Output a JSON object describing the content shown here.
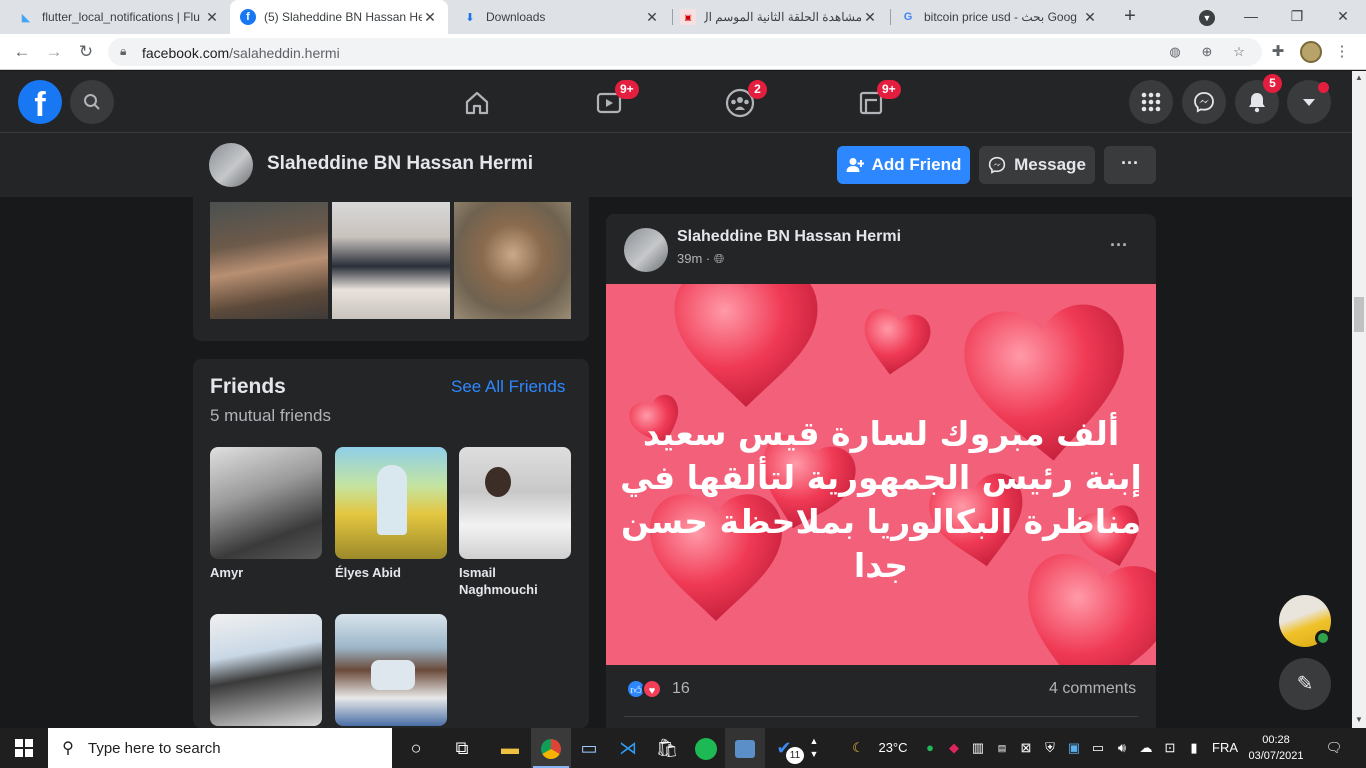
{
  "browser": {
    "tabs": [
      {
        "title": "flutter_local_notifications | Flu",
        "favicon": "flutter-icon",
        "active": false
      },
      {
        "title": "(5) Slaheddine BN Hassan He",
        "favicon": "facebook-icon",
        "active": true
      },
      {
        "title": "Downloads",
        "favicon": "download-icon",
        "active": false
      },
      {
        "title": "مشاهدة الحلقة الثانية الموسم ال",
        "favicon": "site-icon",
        "active": false
      },
      {
        "title": "bitcoin price usd - بحث Goog",
        "favicon": "google-icon",
        "active": false
      }
    ],
    "url_host": "facebook.com",
    "url_path": "/salaheddin.hermi"
  },
  "fbnav": {
    "badges": {
      "watch": "9+",
      "groups": "2",
      "gaming": "9+",
      "notifications": "5"
    }
  },
  "profile_bar": {
    "name": "Slaheddine BN Hassan Hermi",
    "add_friend_label": "Add Friend",
    "message_label": "Message",
    "more_label": "···"
  },
  "friends": {
    "title": "Friends",
    "subtitle": "5 mutual friends",
    "see_all": "See All Friends",
    "items": [
      {
        "name": "Amyr"
      },
      {
        "name": "Élyes Abid"
      },
      {
        "name": "Ismail Naghmouchi"
      },
      {
        "name": ""
      },
      {
        "name": ""
      }
    ]
  },
  "post": {
    "author": "Slaheddine BN Hassan Hermi",
    "time": "39m ·",
    "image_text": "ألف مبروك لسارة قيس سعيد إبنة رئيس الجمهورية لتألقها في مناظرة البكالوريا بملاحظة حسن جدا",
    "reaction_count": "16",
    "comments": "4 comments"
  },
  "taskbar": {
    "search_placeholder": "Type here to search",
    "temperature": "23°C",
    "language": "FRA",
    "time": "00:28",
    "date": "03/07/2021",
    "todo_badge": "11"
  },
  "colors": {
    "fb_blue": "#1877f2",
    "button_blue": "#2d88ff",
    "dark_bg": "#18191a",
    "card_bg": "#242526",
    "post_pink": "#f2607a"
  }
}
